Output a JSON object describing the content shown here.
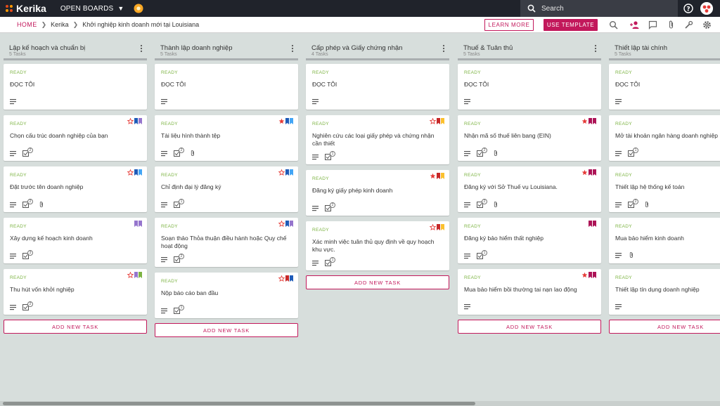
{
  "app": {
    "brand": "Kerika",
    "open_boards_label": "OPEN BOARDS",
    "search_placeholder": "Search"
  },
  "breadcrumb": {
    "home": "HOME",
    "workspace": "Kerika",
    "board": "Khởi nghiệp kinh doanh mới tại Louisiana"
  },
  "actions": {
    "learn_more": "LEARN MORE",
    "use_template": "USE TEMPLATE"
  },
  "colors": {
    "accent": "#c2185b",
    "status_green": "#7cb342",
    "star_red": "#e53935",
    "topbar": "#20232b",
    "board_bg": "#d7dedc"
  },
  "add_task_label": "ADD NEW TASK",
  "columns": [
    {
      "title": "Lập kế hoạch và chuẩn bị",
      "count": "5 Tasks",
      "cards": [
        {
          "status": "READY",
          "title": "ĐỌC TÔI",
          "star": "none",
          "flags": [],
          "checklist": "",
          "attachment": false
        },
        {
          "status": "READY",
          "title": "Chọn cấu trúc doanh nghiệp của bạn",
          "star": "outline",
          "flags": [
            "#1e5bb8",
            "#9575cd"
          ],
          "checklist": "2",
          "attachment": false
        },
        {
          "status": "READY",
          "title": "Đặt trước tên doanh nghiệp",
          "star": "outline",
          "flags": [
            "#1e5bb8",
            "#42a5f5"
          ],
          "checklist": "2",
          "attachment": true
        },
        {
          "status": "READY",
          "title": "Xây dựng kế hoạch kinh doanh",
          "star": "none",
          "flags": [
            "#9575cd",
            "#9575cd"
          ],
          "checklist": "3",
          "attachment": false
        },
        {
          "status": "READY",
          "title": "Thu hút vốn khởi nghiệp",
          "star": "outline",
          "flags": [
            "#9575cd",
            "#7cb342"
          ],
          "checklist": "2",
          "attachment": false
        }
      ]
    },
    {
      "title": "Thành lập doanh nghiệp",
      "count": "5 Tasks",
      "cards": [
        {
          "status": "READY",
          "title": "ĐỌC TÔI",
          "star": "none",
          "flags": [],
          "checklist": "",
          "attachment": false
        },
        {
          "status": "READY",
          "title": "Tài liệu hình thành tệp",
          "star": "filled",
          "flags": [
            "#1e5bb8",
            "#42a5f5"
          ],
          "checklist": "2",
          "attachment": true
        },
        {
          "status": "READY",
          "title": "Chỉ định đại lý đăng ký",
          "star": "outline",
          "flags": [
            "#1e5bb8",
            "#42a5f5"
          ],
          "checklist": "1",
          "attachment": false
        },
        {
          "status": "READY",
          "title": "Soạn thảo Thỏa thuận điều hành hoặc Quy chế hoạt động",
          "star": "outline",
          "flags": [
            "#1e5bb8",
            "#9575cd"
          ],
          "checklist": "2",
          "attachment": false
        },
        {
          "status": "READY",
          "title": "Nộp báo cáo ban đầu",
          "star": "outline",
          "flags": [
            "#c62828",
            "#1e5bb8"
          ],
          "checklist": "1",
          "attachment": false
        }
      ]
    },
    {
      "title": "Cấp phép và Giấy chứng nhận",
      "count": "4 Tasks",
      "cards": [
        {
          "status": "READY",
          "title": "ĐỌC TÔI",
          "star": "none",
          "flags": [],
          "checklist": "",
          "attachment": false
        },
        {
          "status": "READY",
          "title": "Nghiên cứu các loại giấy phép và chứng nhận cần thiết",
          "star": "outline",
          "flags": [
            "#c62828",
            "#fbc02d"
          ],
          "checklist": "1",
          "attachment": false
        },
        {
          "status": "READY",
          "title": "Đăng ký giấy phép kinh doanh",
          "star": "filled",
          "flags": [
            "#c62828",
            "#fbc02d"
          ],
          "checklist": "2",
          "attachment": false
        },
        {
          "status": "READY",
          "title": "Xác minh việc tuân thủ quy định về quy hoạch khu vực.",
          "star": "outline",
          "flags": [
            "#c62828",
            "#fbc02d"
          ],
          "checklist": "1",
          "attachment": false
        }
      ]
    },
    {
      "title": "Thuế & Tuân thủ",
      "count": "5 Tasks",
      "cards": [
        {
          "status": "READY",
          "title": "ĐỌC TÔI",
          "star": "none",
          "flags": [],
          "checklist": "",
          "attachment": false
        },
        {
          "status": "READY",
          "title": "Nhận mã số thuế liên bang (EIN)",
          "star": "filled",
          "flags": [
            "#ad1457",
            "#ad1457"
          ],
          "checklist": "2",
          "attachment": true
        },
        {
          "status": "READY",
          "title": "Đăng ký với Sở Thuế vụ Louisiana.",
          "star": "filled",
          "flags": [
            "#ad1457",
            "#ad1457"
          ],
          "checklist": "2",
          "attachment": true
        },
        {
          "status": "READY",
          "title": "Đăng ký bảo hiểm thất nghiệp",
          "star": "none",
          "flags": [
            "#ad1457",
            "#ad1457"
          ],
          "checklist": "1",
          "attachment": false
        },
        {
          "status": "READY",
          "title": "Mua bảo hiểm bồi thường tai nạn lao động",
          "star": "filled",
          "flags": [
            "#ad1457",
            "#ad1457"
          ],
          "checklist": "",
          "attachment": false
        }
      ]
    },
    {
      "title": "Thiết lập tài chính",
      "count": "5 Tasks",
      "cards": [
        {
          "status": "READY",
          "title": "ĐỌC TÔI",
          "star": "none",
          "flags": [],
          "checklist": "",
          "attachment": false
        },
        {
          "status": "READY",
          "title": "Mở tài khoản ngân hàng doanh nghiệp",
          "star": "none",
          "flags": [],
          "checklist": "1",
          "attachment": false
        },
        {
          "status": "READY",
          "title": "Thiết lập hệ thống kế toán",
          "star": "none",
          "flags": [],
          "checklist": "2",
          "attachment": true
        },
        {
          "status": "READY",
          "title": "Mua bảo hiểm kinh doanh",
          "star": "none",
          "flags": [],
          "checklist": "",
          "attachment": true
        },
        {
          "status": "READY",
          "title": "Thiết lập tín dụng doanh nghiệp",
          "star": "none",
          "flags": [],
          "checklist": "",
          "attachment": false
        }
      ]
    }
  ]
}
